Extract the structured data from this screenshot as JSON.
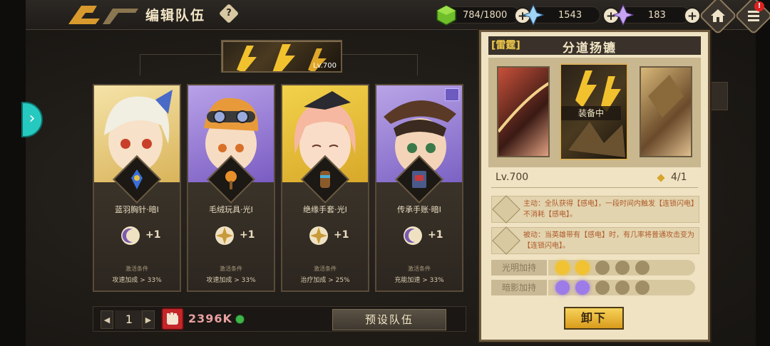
{
  "header": {
    "title": "编辑队伍",
    "help_symbol": "?"
  },
  "resources": {
    "stamina": "784/1800",
    "crystal_blue": "1543",
    "crystal_purple": "183",
    "plus": "+"
  },
  "notification_badge": "!",
  "banner": {
    "level": "Lv.700"
  },
  "heroes": [
    {
      "equipment": "蓝羽胸针·暗I",
      "bonus": "+1",
      "activation_label": "激活条件",
      "condition": "攻速加成 > 33%",
      "element": "dark"
    },
    {
      "equipment": "毛绒玩具·光I",
      "bonus": "+1",
      "activation_label": "激活条件",
      "condition": "攻速加成 > 33%",
      "element": "light"
    },
    {
      "equipment": "绝缘手套·光I",
      "bonus": "+1",
      "activation_label": "激活条件",
      "condition": "治疗加成 > 25%",
      "element": "light"
    },
    {
      "equipment": "传承手账·暗I",
      "bonus": "+1",
      "activation_label": "激活条件",
      "condition": "充能加速 > 33%",
      "element": "dark"
    }
  ],
  "team": {
    "index": "1",
    "prev_symbol": "◀",
    "next_symbol": "▶",
    "power": "2396K",
    "preset_label": "预设队伍"
  },
  "detail": {
    "tag": "[雷霆]",
    "name": "分道扬镳",
    "equipped_label": "装备中",
    "level": "Lv.700",
    "ratio": "4/1",
    "active_skill": "主动：全队获得【感电】，一段时间内触发【连锁闪电】不消耗【感电】。",
    "passive_skill": "被动：当英雄带有【感电】时，有几率将普通攻击变为【连锁闪电】。",
    "light_bonus_label": "光明加持",
    "dark_bonus_label": "暗影加持",
    "light_orbs_active": 2,
    "dark_orbs_active": 2,
    "orbs_total": 5,
    "remove_label": "卸下"
  },
  "colors": {
    "accent_gold": "#f0c94a",
    "panel_bg": "#efe3c3",
    "teal_tab": "#26c9c0",
    "power_red": "#c4262a"
  }
}
